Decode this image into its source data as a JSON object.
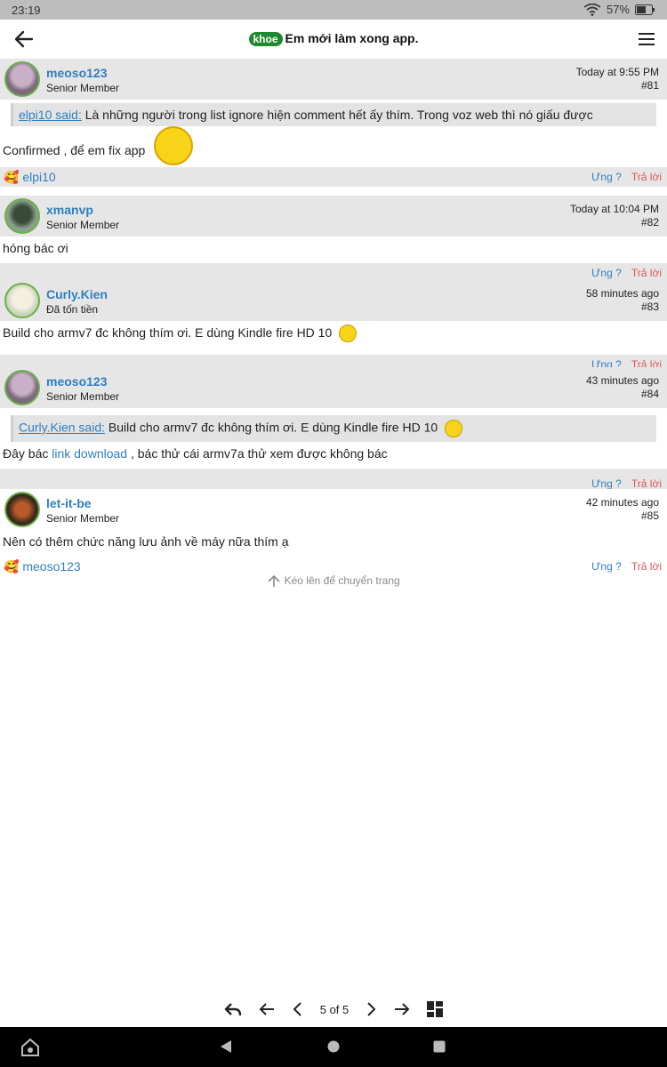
{
  "status": {
    "time": "23:19",
    "battery": "57%"
  },
  "appbar": {
    "tag": "khoe",
    "title": "Em mới làm xong app."
  },
  "posts": [
    {
      "user": "meoso123",
      "role": "Senior Member",
      "time": "Today at 9:55 PM",
      "num": "#81",
      "quote_user": "elpi10 said:",
      "quote_text": " Là những người trong list ignore hiện comment hết ấy thím. Trong voz web thì nó giấu được",
      "body": "Confirmed , để em fix app",
      "react": "elpi10"
    },
    {
      "user": "xmanvp",
      "role": "Senior Member",
      "time": "Today at 10:04 PM",
      "num": "#82",
      "body": "hóng bác ơi"
    },
    {
      "user": "Curly.Kien",
      "role": "Đã tốn tiền",
      "time": "58 minutes ago",
      "num": "#83",
      "body": "Build cho armv7 đc không thím ơi. E dùng Kindle fire HD 10"
    },
    {
      "user": "meoso123",
      "role": "Senior Member",
      "time": "43 minutes ago",
      "num": "#84",
      "quote_user": "Curly.Kien said:",
      "quote_text": " Build cho armv7 đc không thím ơi. E dùng Kindle fire HD 10",
      "body_pre": "Đây bác ",
      "body_link": "link download",
      "body_post": " , bác thử cái armv7a thử xem được không bác"
    },
    {
      "user": "let-it-be",
      "role": "Senior Member",
      "time": "42 minutes ago",
      "num": "#85",
      "body": "Nên có thêm chức năng lưu ảnh về máy nữa thím ạ",
      "react": "meoso123"
    }
  ],
  "actions": {
    "like": "Ưng ?",
    "reply": "Trả lời"
  },
  "hint": "Kéo lên để chuyển trang",
  "pager": {
    "label": "5 of 5"
  },
  "colors": {
    "accent": "#2f7fc1",
    "reply": "#e05555",
    "tag": "#1e8a2e"
  }
}
